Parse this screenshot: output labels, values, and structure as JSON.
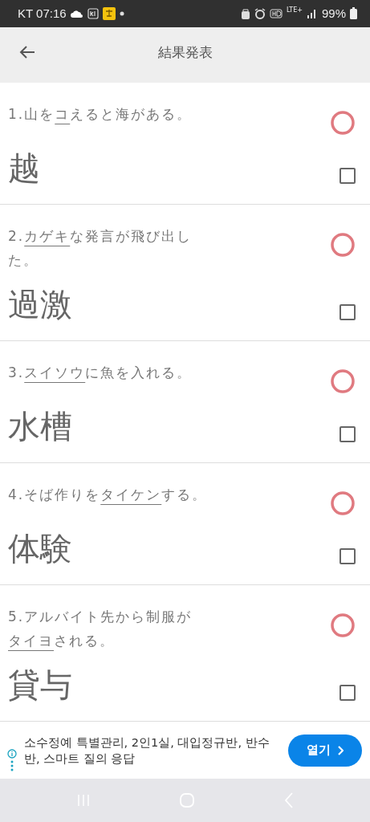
{
  "status_bar": {
    "carrier_time": "KT 07:16",
    "network": "LTE+",
    "battery": "99%"
  },
  "header": {
    "title": "結果発表"
  },
  "items": [
    {
      "number": "1.",
      "question": {
        "before": "山を",
        "target": "コ",
        "after": "えると海がある。"
      },
      "answer": "越",
      "kind": "circle",
      "checked": false
    },
    {
      "number": "2.",
      "question": {
        "target": "カゲキ",
        "after": "な発言が飛び出した。"
      },
      "answer": "過激",
      "kind": "circle",
      "checked": false
    },
    {
      "number": "3.",
      "question": {
        "target": "スイソウ",
        "after": "に魚を入れる。"
      },
      "answer": "水槽",
      "kind": "circle",
      "checked": false
    },
    {
      "number": "4.",
      "question": {
        "before": "そば作りを",
        "target": "タイケン",
        "after": "する。"
      },
      "answer": "体験",
      "kind": "circle",
      "checked": false
    },
    {
      "number": "5.",
      "question": {
        "before": "アルバイト先から制服が",
        "target": "タイヨ",
        "after": "される。"
      },
      "answer": "貸与",
      "kind": "circle",
      "checked": false
    }
  ],
  "ad": {
    "text": "소수정예 특별관리, 2인1실, 대입정규반, 반수반, 스마트 질의 응답",
    "button": "열기"
  }
}
